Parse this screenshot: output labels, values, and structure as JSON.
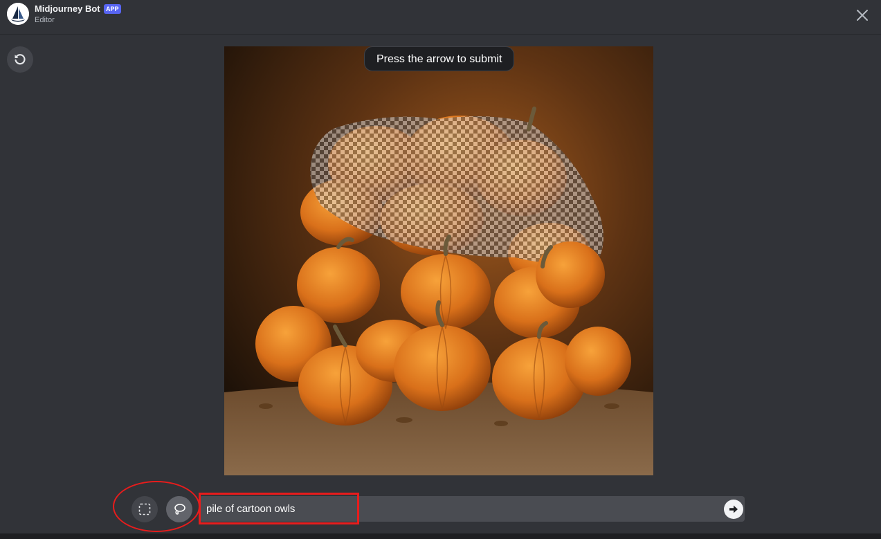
{
  "header": {
    "bot_name": "Midjourney Bot",
    "badge": "APP",
    "subtitle": "Editor",
    "close_icon": "close-icon"
  },
  "toolbar": {
    "reset_icon": "rotate-ccw-icon",
    "rectangle_tool_icon": "rectangle-select-icon",
    "lasso_tool_icon": "lasso-icon",
    "submit_icon": "arrow-right-icon"
  },
  "canvas": {
    "tooltip": "Press the arrow to submit",
    "image_subject": "painted pile of orange pumpkins with erased checkerboard region"
  },
  "prompt": {
    "value": "pile of cartoon owls"
  },
  "colors": {
    "background": "#313338",
    "accent_badge": "#5865f2",
    "annotation": "#e81c1c",
    "pumpkin": "#e07a1a"
  }
}
